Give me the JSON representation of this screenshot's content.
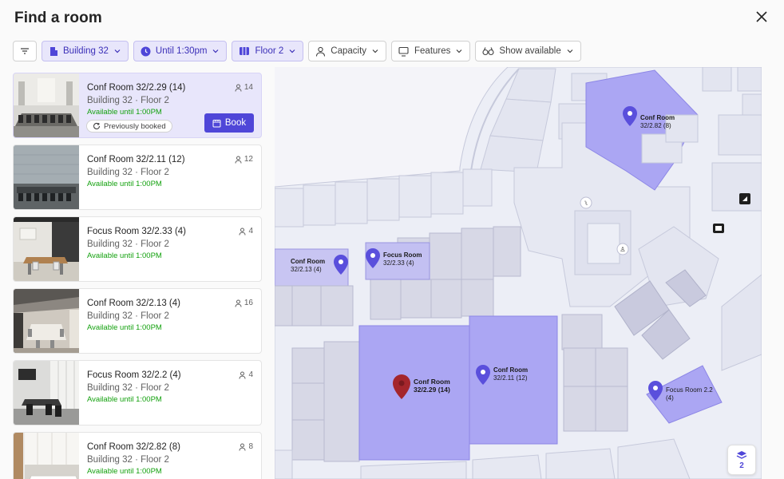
{
  "header": {
    "title": "Find a room"
  },
  "filters": {
    "building": "Building 32",
    "time": "Until 1:30pm",
    "floor": "Floor 2",
    "capacity": "Capacity",
    "features": "Features",
    "show_available": "Show available"
  },
  "rooms": [
    {
      "name": "Conf Room 32/2.29 (14)",
      "location": "Building 32 · Floor 2",
      "availability": "Available until 1:00PM",
      "capacity": "14",
      "previously_booked": "Previously booked",
      "book_label": "Book"
    },
    {
      "name": "Conf Room 32/2.11 (12)",
      "location": "Building 32 · Floor 2",
      "availability": "Available until 1:00PM",
      "capacity": "12"
    },
    {
      "name": "Focus Room 32/2.33 (4)",
      "location": "Building 32 · Floor 2",
      "availability": "Available until 1:00PM",
      "capacity": "4"
    },
    {
      "name": "Conf Room 32/2.13 (4)",
      "location": "Building 32 · Floor 2",
      "availability": "Available until 1:00PM",
      "capacity": "16"
    },
    {
      "name": "Focus Room 32/2.2 (4)",
      "location": "Building 32 · Floor 2",
      "availability": "Available until 1:00PM",
      "capacity": "4"
    },
    {
      "name": "Conf Room 32/2.82 (8)",
      "location": "Building 32 · Floor 2",
      "availability": "Available until 1:00PM",
      "capacity": "8"
    }
  ],
  "map": {
    "labels": {
      "r282a": "Conf Room",
      "r282b": "32/2.82 (8)",
      "r213a": "Conf Room",
      "r213b": "32/2.13 (4)",
      "r233a": "Focus Room",
      "r233b": "32/2.33 (4)",
      "r229a": "Conf Room",
      "r229b": "32/2.29 (14)",
      "r211a": "Conf Room",
      "r211b": "32/2.11 (12)",
      "r22a": "Focus Room 2.2",
      "r22b": "(4)"
    },
    "floor_level": "2"
  },
  "colors": {
    "accent": "#4f46d8",
    "selected_bg": "#e8e6fb",
    "available": "#13a10e",
    "room_fill": "#a9a4f2",
    "selected_pin": "#a4262c"
  }
}
